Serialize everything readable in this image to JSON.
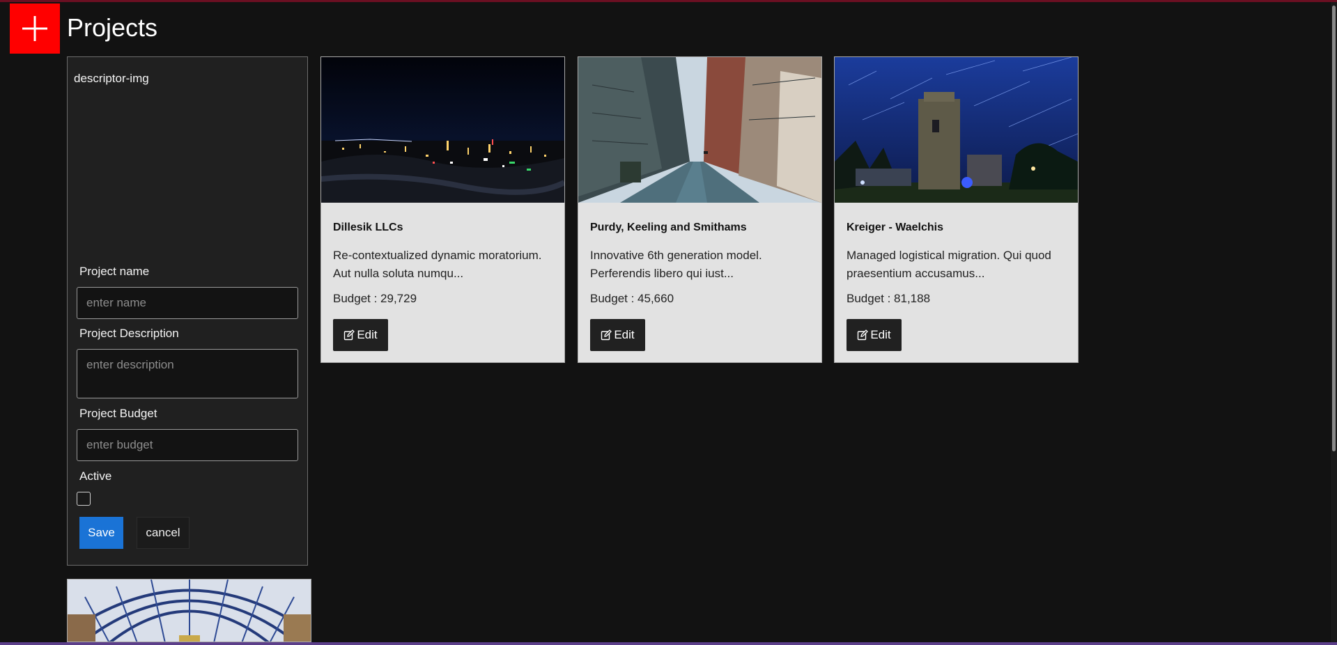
{
  "header": {
    "title": "Projects",
    "logo_icon": "plus-icon",
    "logo_color": "#ff0000"
  },
  "form": {
    "descriptor_text": "descriptor-img",
    "name_label": "Project name",
    "name_placeholder": "enter name",
    "description_label": "Project Description",
    "description_placeholder": "enter description",
    "budget_label": "Project Budget",
    "budget_placeholder": "enter budget",
    "active_label": "Active",
    "active_checked": false,
    "save_label": "Save",
    "cancel_label": "cancel",
    "save_color": "#1a73d6"
  },
  "projects": [
    {
      "name": "Dillesik LLCs",
      "description": "Re-contextualized dynamic moratorium. Aut nulla soluta numqu...",
      "budget": "Budget : 29,729",
      "edit_label": "Edit",
      "image": "city-skyline-night"
    },
    {
      "name": "Purdy, Keeling and Smithams",
      "description": "Innovative 6th generation model. Perferendis libero qui iust...",
      "budget": "Budget : 45,660",
      "edit_label": "Edit",
      "image": "city-street"
    },
    {
      "name": "Kreiger - Waelchis",
      "description": "Managed logistical migration. Qui quod praesentium accusamus...",
      "budget": "Budget : 81,188",
      "edit_label": "Edit",
      "image": "tower-star-trails"
    }
  ],
  "peek_card_image": "glass-roof-arcade"
}
